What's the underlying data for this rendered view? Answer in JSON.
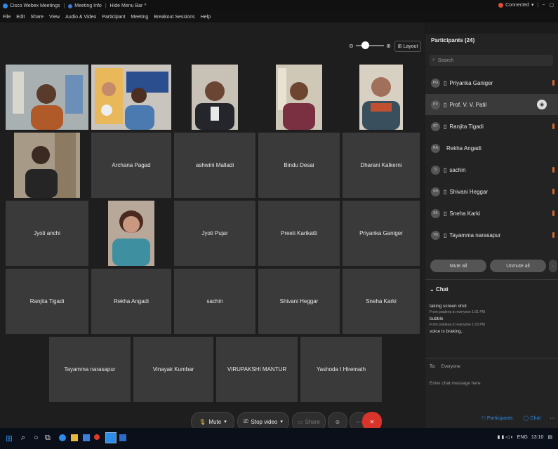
{
  "titlebar": {
    "app": "Cisco Webex Meetings",
    "meeting_info": "Meeting Info",
    "hide_menu": "Hide Menu Bar ^",
    "status": "Connected",
    "controls": [
      "−",
      "▢"
    ]
  },
  "menubar": {
    "items": [
      "File",
      "Edit",
      "Share",
      "View",
      "Audio & Video",
      "Participant",
      "Meeting",
      "Breakout Sessions",
      "Help"
    ]
  },
  "view": {
    "layout_label": "Layout"
  },
  "grid": {
    "row2": [
      "Archana Pagad",
      "ashwini Malladi",
      "Bindu Desai",
      "Dharani Kalkerni"
    ],
    "row3a": "Jyoti anchi",
    "row3b": [
      "Jyoti Pujar",
      "Preeti Karikatti",
      "Priyanka Ganiger"
    ],
    "row4": [
      "Ranjita Tigadi",
      "Rekha Angadi",
      "sachin",
      "Shivani Heggar",
      "Sneha Karki"
    ],
    "row5": [
      "Tayamma narasapur",
      "Vinayak Kumbar",
      "VIRUPAKSHI MANTUR",
      "Yashoda I Hiremath"
    ]
  },
  "toolbar": {
    "mute": "Mute",
    "stop_video": "Stop video",
    "share": "Share"
  },
  "participants": {
    "header": "Participants (24)",
    "search_placeholder": "Search",
    "list": [
      {
        "initials": "PG",
        "name": "Priyanka Ganiger"
      },
      {
        "initials": "PV",
        "name": "Prof. V. V. Patil"
      },
      {
        "initials": "RT",
        "name": "Ranjita Tigadi"
      },
      {
        "initials": "RA",
        "name": "Rekha Angadi"
      },
      {
        "initials": "S",
        "name": "sachin"
      },
      {
        "initials": "SH",
        "name": "Shivani Heggar"
      },
      {
        "initials": "SK",
        "name": "Sneha Karki"
      },
      {
        "initials": "TN",
        "name": "Tayamma narasapur"
      }
    ],
    "mute_all": "Mute all",
    "unmute_all": "Unmute all"
  },
  "chat": {
    "header": "Chat",
    "messages": [
      {
        "text": "taking screen shot",
        "meta": "From pradeep to everyone   1:01 PM"
      },
      {
        "text": "bubble",
        "meta": "From pradeep to everyone   1:03 PM"
      },
      {
        "text": "voice is braking..",
        "meta": ""
      }
    ],
    "to_label": "To:",
    "to_value": "Everyone",
    "input_placeholder": "Enter chat message here"
  },
  "bottom_tabs": {
    "participants": "Participants",
    "chat": "Chat"
  },
  "taskbar": {
    "lang": "ENG",
    "time": "13:10"
  },
  "colors": {
    "end_call": "#d9342b",
    "connected_dot": "#e04b3a",
    "mic_active": "#d0682b",
    "accent": "#2d8ce6"
  }
}
